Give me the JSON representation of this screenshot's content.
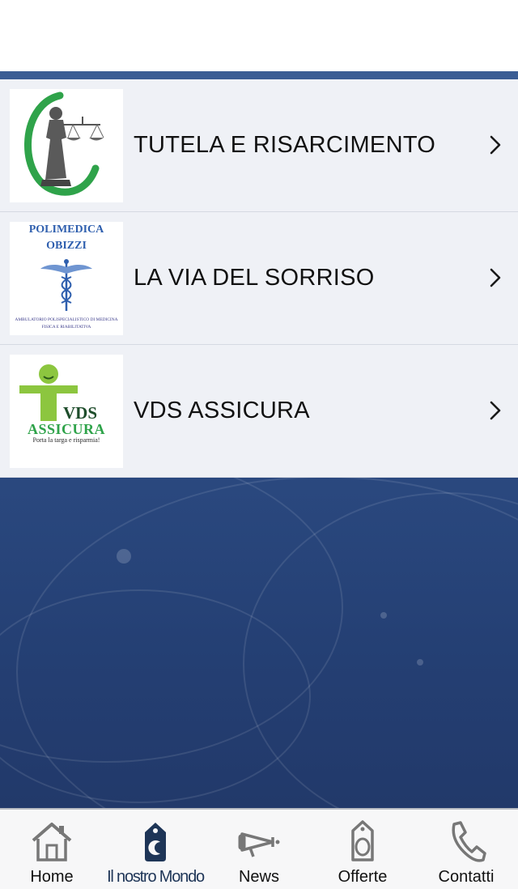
{
  "list": {
    "items": [
      {
        "label": "TUTELA E RISARCIMENTO",
        "icon": "justice-logo"
      },
      {
        "label": "LA VIA DEL SORRISO",
        "icon": "caduceus-logo",
        "logo_title_1": "POLIMEDICA",
        "logo_title_2": "OBIZZI",
        "logo_caption_1": "AMBULATORIO POLISPECIALISTICO DI MEDICINA",
        "logo_caption_2": "FISICA E RIABILITATIVA"
      },
      {
        "label": "VDS ASSICURA",
        "icon": "vds-logo",
        "logo_title_1": "VDS",
        "logo_title_2": "ASSICURA",
        "logo_caption": "Porta la targa e risparmia!"
      }
    ]
  },
  "tabbar": {
    "tabs": [
      {
        "label": "Home",
        "icon": "home-icon"
      },
      {
        "label": "Il nostro Mondo",
        "icon": "tag-icon",
        "active": true
      },
      {
        "label": "News",
        "icon": "megaphone-icon"
      },
      {
        "label": "Offerte",
        "icon": "label-icon"
      },
      {
        "label": "Contatti",
        "icon": "phone-icon"
      }
    ]
  },
  "colors": {
    "accent": "#1e3557",
    "background_blue": "#2e4e86",
    "row_background": "#eff1f6",
    "logo_green": "#2fa34a",
    "vds_green": "#8cc63f"
  }
}
